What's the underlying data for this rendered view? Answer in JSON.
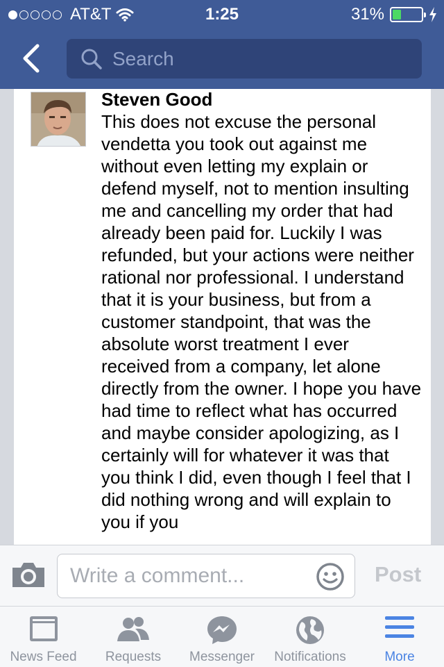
{
  "status_bar": {
    "carrier": "AT&T",
    "time": "1:25",
    "battery_percent": "31%",
    "battery_level": 0.31
  },
  "nav": {
    "back_icon": "chevron-left-icon",
    "search_placeholder": "Search"
  },
  "comment": {
    "author": "Steven Good",
    "text": "This does not excuse the personal vendetta you took out against me without even letting my explain or defend myself, not to mention insulting me and cancelling my order that had already been paid for. Luckily I was refunded, but your actions were neither rational nor professional. I understand that it is your business, but from a customer standpoint, that was the absolute worst treatment I ever received from a company, let alone directly from the owner. I hope you have had time to reflect what has occurred and maybe consider apologizing, as I certainly will for whatever it was that you think I did, even though I feel that I did nothing wrong and will explain to you if you"
  },
  "composer": {
    "placeholder": "Write a comment...",
    "post_label": "Post"
  },
  "tabs": [
    {
      "label": "News Feed",
      "icon": "news-feed-icon",
      "active": false
    },
    {
      "label": "Requests",
      "icon": "requests-icon",
      "active": false
    },
    {
      "label": "Messenger",
      "icon": "messenger-icon",
      "active": false
    },
    {
      "label": "Notifications",
      "icon": "globe-icon",
      "active": false
    },
    {
      "label": "More",
      "icon": "menu-icon",
      "active": true
    }
  ],
  "colors": {
    "brand_blue": "#3f5b97",
    "active_tab": "#4b84e3",
    "battery_green": "#4cd964"
  }
}
